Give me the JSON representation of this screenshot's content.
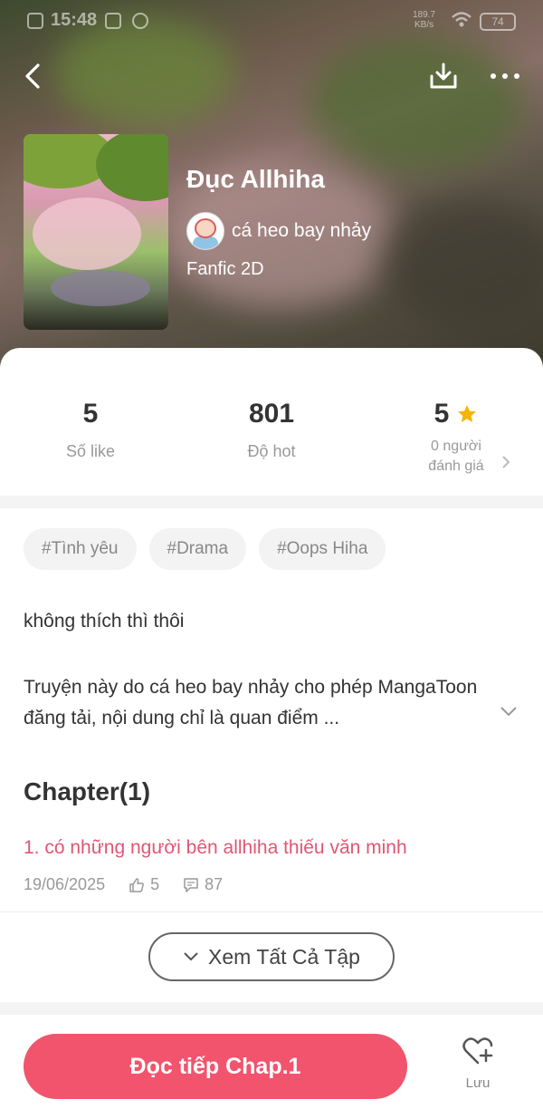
{
  "status_bar": {
    "time": "15:48",
    "net_speed": "189.7",
    "net_unit": "KB/s",
    "battery": "74"
  },
  "header": {
    "back_icon": "chevron-left-icon",
    "download_icon": "download-icon",
    "more_icon": "more-horizontal-icon"
  },
  "story": {
    "title": "Đục Allhiha",
    "author": "cá heo bay nhảy",
    "genre": "Fanfic 2D"
  },
  "stats": {
    "likes": {
      "value": "5",
      "label": "Số like"
    },
    "hot": {
      "value": "801",
      "label": "Độ hot"
    },
    "rating": {
      "value": "5",
      "label_line1": "0 người",
      "label_line2": "đánh giá"
    }
  },
  "tags": [
    "#Tình yêu",
    "#Drama",
    "#Oops Hiha"
  ],
  "description": {
    "line1": "không thích thì thôi",
    "line2": "Truyện này do cá heo bay nhảy cho phép MangaToon đăng tải, nội dung chỉ là quan điểm ..."
  },
  "chapters": {
    "heading": "Chapter(1)",
    "items": [
      {
        "title": "1. có những người bên allhiha thiếu văn minh",
        "date": "19/06/2025",
        "likes": "5",
        "comments": "87"
      }
    ],
    "see_all_label": "Xem Tất Cả Tập"
  },
  "bottom_bar": {
    "read_button_label": "Đọc tiếp Chap.1",
    "save_label": "Lưu"
  },
  "colors": {
    "accent": "#f2546d",
    "chapter_link": "#e25574",
    "star": "#f5b400"
  }
}
